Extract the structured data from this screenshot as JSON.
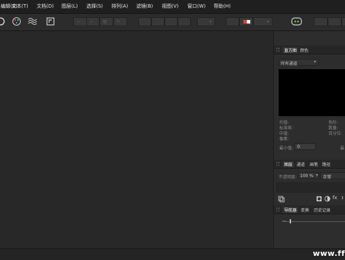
{
  "menu": [
    "编辑(E)",
    "文本(T)",
    "文档(D)",
    "图层(L)",
    "选择(S)",
    "排列(A)",
    "滤镜(B)",
    "视图(V)",
    "窗口(W)",
    "帮助(H)"
  ],
  "histogram": {
    "tabs": [
      "直方图",
      "颜色"
    ],
    "channel": "所有通道",
    "stats_left": [
      "均值:",
      "标准差:",
      "中值:",
      "像素:"
    ],
    "stats_right": [
      "色阶:",
      "数量:",
      "百分位:"
    ],
    "min_label": "最小值:",
    "min_value": "0",
    "max_label": "最"
  },
  "layers": {
    "tabs": [
      "图层",
      "通道",
      "画笔",
      "路径"
    ],
    "opacity_label": "不透明度:",
    "opacity_value": "100 %",
    "blend_mode": "正常"
  },
  "navigator": {
    "tabs": [
      "导航器",
      "变换",
      "历史记录"
    ]
  },
  "watermark": "www.ff",
  "colors": {
    "menubar": "#1f1f1f",
    "toolbar": "#2c2c2c",
    "canvas": "#282828",
    "panel": "#2d2d2d",
    "histogram_area": "#000000"
  }
}
